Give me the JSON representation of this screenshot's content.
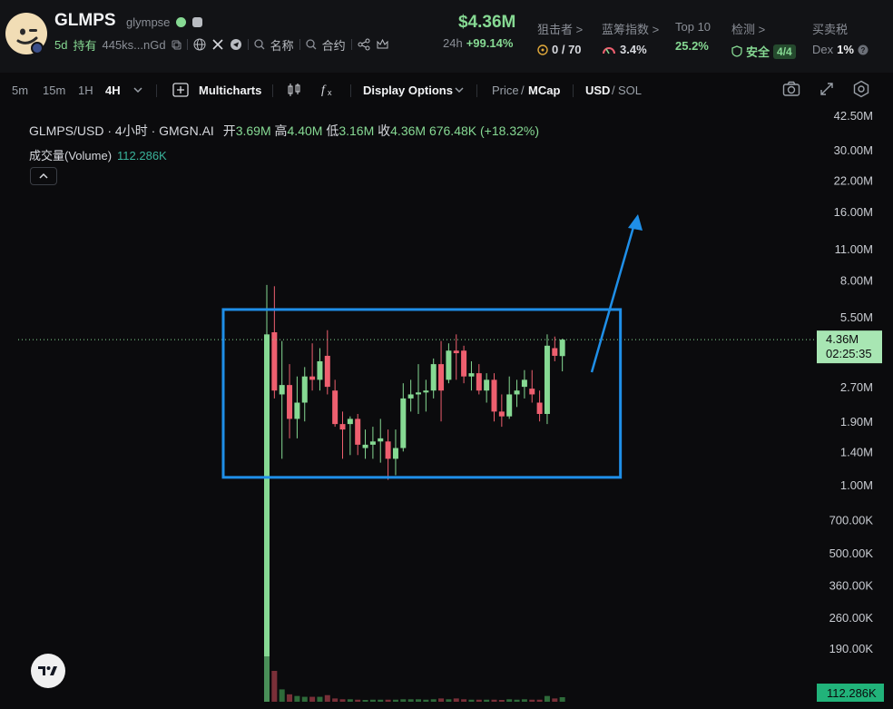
{
  "header": {
    "token": {
      "symbol": "GLMPS",
      "name": "glympse"
    },
    "age": "5d",
    "holders_label": "持有",
    "address": "445ks...nGd",
    "links": {
      "name_label": "名称",
      "contract_label": "合约"
    },
    "price": {
      "value": "$4.36M",
      "period": "24h",
      "change": "+99.14%"
    },
    "stats": [
      {
        "label": "狙击者 >",
        "value": "0 / 70",
        "icon": "target-icon",
        "color": "#d7d9de"
      },
      {
        "label": "蓝筹指数 >",
        "value": "3.4%",
        "icon": "gauge-icon",
        "color": "#d7d9de"
      },
      {
        "label": "Top 10",
        "value": "25.2%",
        "icon": "",
        "color": "#86d993"
      },
      {
        "label": "检测 >",
        "value": "安全",
        "badge": "4/4",
        "icon": "shield-icon",
        "color": "#86d993"
      },
      {
        "label": "买卖税",
        "value_prefix": "Dex",
        "value": "1%",
        "icon": "help-icon",
        "color": "#f2f3f5"
      }
    ]
  },
  "toolbar": {
    "intervals": [
      "5m",
      "15m",
      "1H",
      "4H"
    ],
    "active_interval": "4H",
    "multicharts_label": "Multicharts",
    "display_options_label": "Display Options",
    "price_label": "Price",
    "mcap_label": "MCap",
    "usd_label": "USD",
    "sol_label": "SOL"
  },
  "chart_data": {
    "type": "candlestick",
    "title": "GLMPS/USD · 4小时 · GMGN.AI",
    "ohlc_summary": {
      "open_label": "开",
      "open": "3.69M",
      "high_label": "高",
      "high": "4.40M",
      "low_label": "低",
      "low": "3.16M",
      "close_label": "收",
      "close": "4.36M",
      "volume": "676.48K",
      "change": "(+18.32%)"
    },
    "volume_label": "成交量(Volume)",
    "volume_value": "112.286K",
    "y_scale": "log",
    "y_ticks": [
      "42.50M",
      "30.00M",
      "22.00M",
      "16.00M",
      "11.00M",
      "8.00M",
      "5.50M",
      "4.36M",
      "2.70M",
      "1.90M",
      "1.40M",
      "1.00M",
      "700.00K",
      "500.00K",
      "360.00K",
      "260.00K",
      "190.00K"
    ],
    "y_tick_values": [
      42.5,
      30,
      22,
      16,
      11,
      8,
      5.5,
      4.36,
      2.7,
      1.9,
      1.4,
      1.0,
      0.7,
      0.5,
      0.36,
      0.26,
      0.19
    ],
    "ylim": [
      0.17,
      45
    ],
    "current_price_label": "4.36M",
    "countdown": "02:25:35",
    "volume_badge": "112.286K",
    "candles": [
      {
        "o": 0.17,
        "h": 7.6,
        "l": 0.17,
        "c": 4.6
      },
      {
        "o": 4.7,
        "h": 7.5,
        "l": 2.4,
        "c": 2.6
      },
      {
        "o": 2.5,
        "h": 4.3,
        "l": 1.3,
        "c": 2.75
      },
      {
        "o": 2.75,
        "h": 3.4,
        "l": 1.6,
        "c": 1.95
      },
      {
        "o": 1.95,
        "h": 3.0,
        "l": 1.6,
        "c": 2.3
      },
      {
        "o": 2.3,
        "h": 3.3,
        "l": 1.9,
        "c": 3.0
      },
      {
        "o": 3.0,
        "h": 4.2,
        "l": 2.6,
        "c": 2.9
      },
      {
        "o": 2.9,
        "h": 4.0,
        "l": 2.6,
        "c": 3.5
      },
      {
        "o": 3.7,
        "h": 4.8,
        "l": 2.5,
        "c": 2.7
      },
      {
        "o": 2.6,
        "h": 2.9,
        "l": 1.8,
        "c": 1.85
      },
      {
        "o": 1.85,
        "h": 2.1,
        "l": 1.3,
        "c": 1.75
      },
      {
        "o": 1.85,
        "h": 2.0,
        "l": 1.35,
        "c": 1.95
      },
      {
        "o": 1.95,
        "h": 2.05,
        "l": 1.35,
        "c": 1.5
      },
      {
        "o": 1.45,
        "h": 1.75,
        "l": 1.3,
        "c": 1.5
      },
      {
        "o": 1.5,
        "h": 1.8,
        "l": 1.3,
        "c": 1.55
      },
      {
        "o": 1.55,
        "h": 1.95,
        "l": 1.25,
        "c": 1.6
      },
      {
        "o": 1.55,
        "h": 1.75,
        "l": 1.05,
        "c": 1.3
      },
      {
        "o": 1.3,
        "h": 1.75,
        "l": 1.1,
        "c": 1.45
      },
      {
        "o": 1.45,
        "h": 2.8,
        "l": 1.4,
        "c": 2.4
      },
      {
        "o": 2.4,
        "h": 2.9,
        "l": 2.1,
        "c": 2.5
      },
      {
        "o": 2.5,
        "h": 3.4,
        "l": 2.05,
        "c": 2.55
      },
      {
        "o": 2.55,
        "h": 2.9,
        "l": 2.1,
        "c": 2.6
      },
      {
        "o": 2.6,
        "h": 3.6,
        "l": 2.4,
        "c": 3.4
      },
      {
        "o": 3.4,
        "h": 4.3,
        "l": 1.9,
        "c": 2.6
      },
      {
        "o": 2.9,
        "h": 4.2,
        "l": 2.8,
        "c": 3.9
      },
      {
        "o": 3.9,
        "h": 4.6,
        "l": 2.9,
        "c": 3.8
      },
      {
        "o": 3.9,
        "h": 4.1,
        "l": 2.8,
        "c": 3.0
      },
      {
        "o": 3.0,
        "h": 3.5,
        "l": 2.6,
        "c": 3.1
      },
      {
        "o": 3.1,
        "h": 3.4,
        "l": 2.5,
        "c": 2.6
      },
      {
        "o": 2.6,
        "h": 3.1,
        "l": 2.3,
        "c": 2.9
      },
      {
        "o": 2.9,
        "h": 3.1,
        "l": 1.9,
        "c": 2.1
      },
      {
        "o": 2.1,
        "h": 2.5,
        "l": 1.8,
        "c": 2.0
      },
      {
        "o": 2.0,
        "h": 3.0,
        "l": 1.95,
        "c": 2.5
      },
      {
        "o": 2.5,
        "h": 2.9,
        "l": 2.2,
        "c": 2.6
      },
      {
        "o": 2.7,
        "h": 3.2,
        "l": 2.4,
        "c": 2.9
      },
      {
        "o": 2.65,
        "h": 3.2,
        "l": 2.3,
        "c": 2.5
      },
      {
        "o": 2.3,
        "h": 2.6,
        "l": 1.9,
        "c": 2.05
      },
      {
        "o": 2.05,
        "h": 4.6,
        "l": 1.85,
        "c": 4.1
      },
      {
        "o": 4.0,
        "h": 4.5,
        "l": 3.5,
        "c": 3.7
      },
      {
        "o": 3.69,
        "h": 4.4,
        "l": 3.16,
        "c": 4.36
      }
    ],
    "volumes": [
      1000,
      75,
      30,
      18,
      14,
      12,
      12,
      12,
      16,
      8,
      6,
      6,
      5,
      4,
      5,
      5,
      5,
      5,
      6,
      6,
      6,
      5,
      6,
      8,
      6,
      8,
      6,
      5,
      5,
      5,
      5,
      4,
      6,
      5,
      6,
      5,
      5,
      14,
      8,
      11
    ],
    "up_color": "#86d993",
    "down_color": "#ee5f6f",
    "annotations": [
      {
        "type": "rectangle",
        "color": "#1f8fe8",
        "from_candle": 0,
        "to_candle": 39,
        "top": 5.5,
        "bottom": 1.0
      },
      {
        "type": "arrow",
        "color": "#1f8fe8",
        "direction": "up"
      }
    ]
  }
}
